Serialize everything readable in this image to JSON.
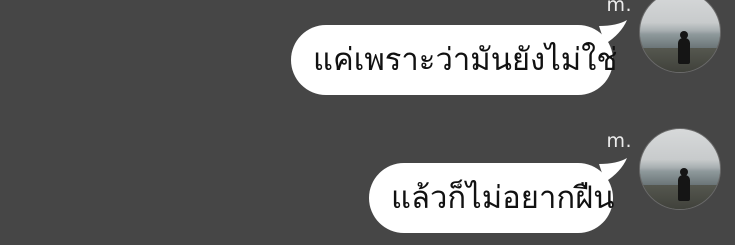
{
  "messages": [
    {
      "sender": "m.",
      "text": "แค่เพราะว่ามันยังไม่ใช่",
      "avatar_icon": "profile-photo-person-at-beach"
    },
    {
      "sender": "m.",
      "text": "แล้วก็ไม่อยากฝืน",
      "avatar_icon": "profile-photo-person-at-beach"
    }
  ],
  "colors": {
    "background": "#464646",
    "bubble": "#ffffff",
    "bubble_text": "#111111",
    "sender_text": "#ececec"
  }
}
